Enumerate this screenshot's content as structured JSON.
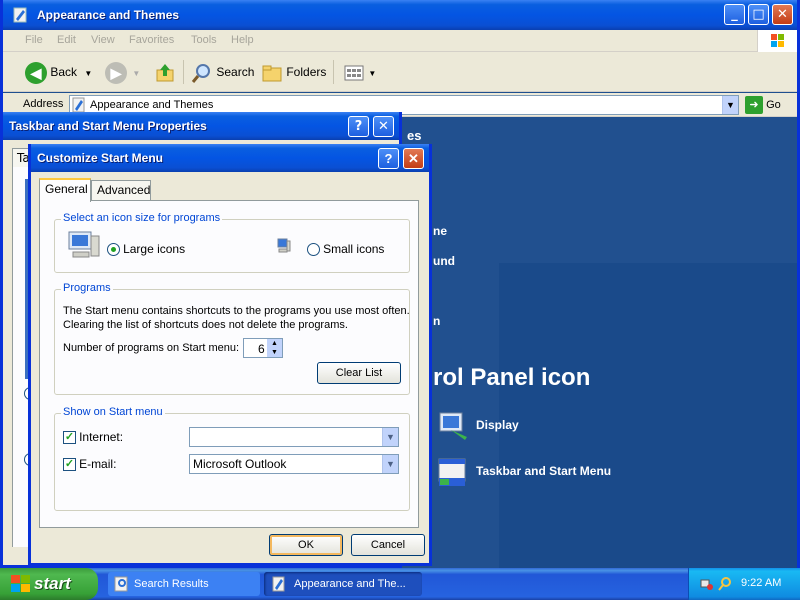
{
  "explorer": {
    "title": "Appearance and Themes",
    "menu": [
      "File",
      "Edit",
      "View",
      "Favorites",
      "Tools",
      "Help"
    ],
    "toolbar": {
      "back_label": "Back",
      "search_label": "Search",
      "folders_label": "Folders"
    },
    "address": {
      "label": "Address",
      "value": "Appearance and Themes",
      "go_label": "Go"
    },
    "content": {
      "partial_heading_fragment_1": "es",
      "partial_text_1": "ne",
      "partial_text_2": "und",
      "partial_text_3": "n",
      "control_panel_heading": "rol Panel icon",
      "items": [
        {
          "label": "Display",
          "icon": "display-icon"
        },
        {
          "label": "Taskbar and Start Menu",
          "icon": "taskbar-icon"
        }
      ]
    }
  },
  "taskbar_properties": {
    "title": "Taskbar and Start Menu Properties",
    "tab_fragment": "Ta"
  },
  "customize_dialog": {
    "title": "Customize Start Menu",
    "tabs": [
      "General",
      "Advanced"
    ],
    "icon_size_group": {
      "label": "Select an icon size for programs",
      "large_label": "Large icons",
      "small_label": "Small icons",
      "selected": "large"
    },
    "programs_group": {
      "label": "Programs",
      "description_line1": "The Start menu contains shortcuts to the programs you use most often.",
      "description_line2": "Clearing the list of shortcuts does not delete the programs.",
      "count_label": "Number of programs on Start menu:",
      "count_value": "6",
      "clear_list_label": "Clear List"
    },
    "show_group": {
      "label": "Show on Start menu",
      "internet_label": "Internet:",
      "internet_checked": true,
      "internet_value": "",
      "email_label": "E-mail:",
      "email_checked": true,
      "email_value": "Microsoft Outlook"
    },
    "ok_label": "OK",
    "cancel_label": "Cancel"
  },
  "taskbar": {
    "start_label": "start",
    "tasks": [
      {
        "label": "Search Results",
        "active": false
      },
      {
        "label": "Appearance and The...",
        "active": true
      }
    ],
    "clock": "9:22 AM"
  },
  "colors": {
    "title_blue": "#0455e3",
    "close_red": "#c33c15",
    "start_green": "#37a137",
    "group_label_blue": "#0046d5"
  }
}
